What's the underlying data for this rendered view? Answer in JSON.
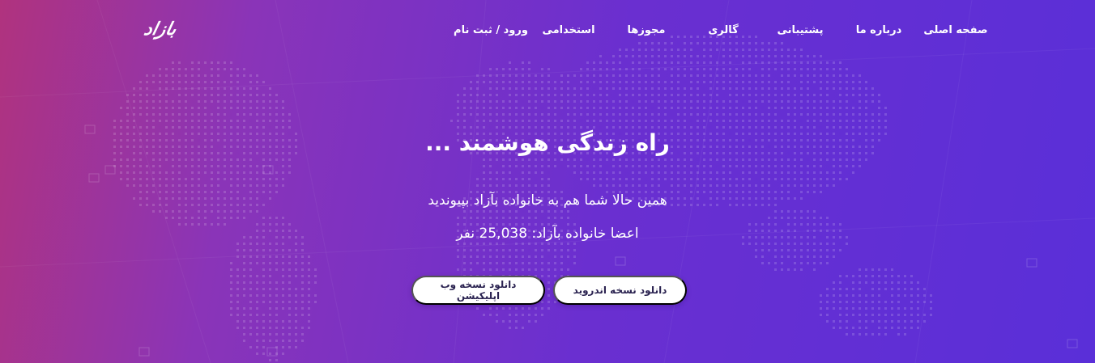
{
  "logo": {
    "text": "بازاد"
  },
  "nav": {
    "items": [
      {
        "id": "home",
        "label": "صفحه اصلی"
      },
      {
        "id": "about",
        "label": "درباره ما"
      },
      {
        "id": "support",
        "label": "پشتیبانی"
      },
      {
        "id": "gallery",
        "label": "گالری"
      },
      {
        "id": "licenses",
        "label": "مجوزها"
      },
      {
        "id": "careers",
        "label": "استخدامی"
      },
      {
        "id": "login",
        "label": "ورود / ثبت نام"
      }
    ]
  },
  "hero": {
    "title": "راه زندگی هوشمند ...",
    "subtitle": "همین حالا شما هم به خانواده بآزاد بپیوندید",
    "members": "اعضا خانواده بآزاد: 25,038 نفر"
  },
  "buttons": {
    "android": "دانلود نسخه اندروید",
    "web": "دانلود نسخه وب اپلیکیشن"
  },
  "colors": {
    "gradient_start": "#b0337e",
    "gradient_mid": "#8a34b8",
    "gradient_end": "#5a2fd8",
    "button_bg": "#ffffff",
    "button_text": "#2a2250"
  }
}
